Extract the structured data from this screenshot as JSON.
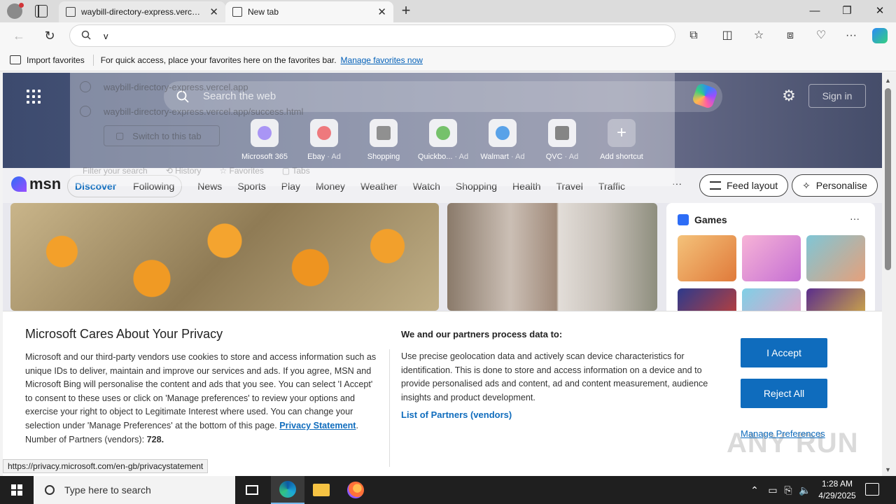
{
  "browser": {
    "tabs": [
      {
        "title": "waybill-directory-express.vercel.app",
        "close": "✕"
      },
      {
        "title": "New tab",
        "close": "✕"
      }
    ],
    "new_tab": "+",
    "window": {
      "minimize": "—",
      "maximize": "❐",
      "close": "✕"
    },
    "address_value": "v",
    "favorites": {
      "import_label": "Import favorites",
      "hint": "For quick access, place your favorites here on the favorites bar.",
      "manage_link": "Manage favorites now"
    }
  },
  "suggestions": {
    "items": [
      "waybill-directory-express.vercel.app",
      "waybill-directory-express.vercel.app/success.html"
    ],
    "switch_tab": "Switch to this tab",
    "footer": [
      "Filter your search",
      "History",
      "Favorites",
      "Tabs"
    ]
  },
  "newtab": {
    "search_placeholder": "Search the web",
    "signin": "Sign in",
    "shortcuts": [
      {
        "name": "Microsoft 365",
        "ad": "",
        "color": "#7b5cf0"
      },
      {
        "name": "Ebay",
        "ad": "· Ad",
        "color": "#e53238"
      },
      {
        "name": "Shopping",
        "ad": "",
        "color": "#555555"
      },
      {
        "name": "Quickbo...",
        "ad": "· Ad",
        "color": "#2ca01c"
      },
      {
        "name": "Walmart",
        "ad": "· Ad",
        "color": "#0071dc"
      },
      {
        "name": "QVC",
        "ad": "· Ad",
        "color": "#444444"
      },
      {
        "name": "Add shortcut",
        "ad": "",
        "color": "#888888"
      }
    ],
    "msn": {
      "logo": "msn",
      "tabs": [
        "Discover",
        "Following"
      ],
      "categories": [
        "News",
        "Sports",
        "Play",
        "Money",
        "Weather",
        "Watch",
        "Shopping",
        "Health",
        "Travel",
        "Traffic"
      ],
      "more": "···",
      "feed_layout": "Feed layout",
      "personalise": "Personalise"
    },
    "games": {
      "title": "Games",
      "more": "···"
    }
  },
  "privacy": {
    "title": "Microsoft Cares About Your Privacy",
    "body": "Microsoft and our third-party vendors use cookies to store and access information such as unique IDs to deliver, maintain and improve our services and ads. If you agree, MSN and Microsoft Bing will personalise the content and ads that you see. You can select 'I Accept' to consent to these uses or click on 'Manage preferences' to review your options and exercise your right to object to Legitimate Interest where used.  You can change your selection under 'Manage Preferences' at the bottom of this page.",
    "statement_link": "Privacy Statement",
    "partners_label": "Number of Partners (vendors):",
    "partners_count": "728.",
    "process_title": "We and our partners process data to:",
    "process_text": "Use precise geolocation data and actively scan device characteristics for identification. This is done to store and access information on a device and to provide personalised ads and content, ad and content measurement, audience insights and product development.",
    "partners_link": "List of Partners (vendors)",
    "accept": "I Accept",
    "reject": "Reject All",
    "manage": "Manage Preferences"
  },
  "status_url": "https://privacy.microsoft.com/en-gb/privacystatement",
  "watermark": "ANY RUN",
  "taskbar": {
    "search_placeholder": "Type here to search",
    "time": "1:28 AM",
    "date": "4/29/2025"
  }
}
